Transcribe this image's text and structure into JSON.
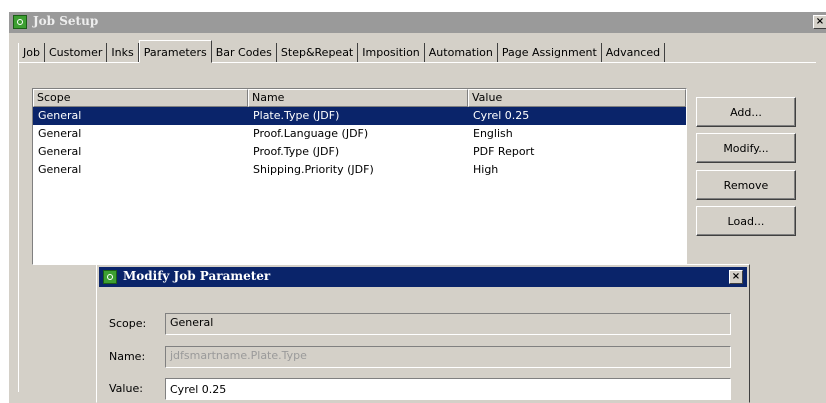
{
  "window": {
    "title": "Job Setup",
    "close_glyph": "×"
  },
  "tabs": [
    {
      "label": "Job"
    },
    {
      "label": "Customer"
    },
    {
      "label": "Inks"
    },
    {
      "label": "Parameters",
      "active": true
    },
    {
      "label": "Bar Codes"
    },
    {
      "label": "Step&Repeat"
    },
    {
      "label": "Imposition"
    },
    {
      "label": "Automation"
    },
    {
      "label": "Page Assignment"
    },
    {
      "label": "Advanced"
    }
  ],
  "table": {
    "columns": [
      "Scope",
      "Name",
      "Value"
    ],
    "rows": [
      {
        "scope": "General",
        "name": "Plate.Type (JDF)",
        "value": "Cyrel 0.25",
        "selected": true
      },
      {
        "scope": "General",
        "name": "Proof.Language (JDF)",
        "value": "English"
      },
      {
        "scope": "General",
        "name": "Proof.Type (JDF)",
        "value": "PDF Report"
      },
      {
        "scope": "General",
        "name": "Shipping.Priority (JDF)",
        "value": "High"
      }
    ]
  },
  "buttons": {
    "add": "Add...",
    "modify": "Modify...",
    "remove": "Remove",
    "load": "Load..."
  },
  "dialog": {
    "title": "Modify Job Parameter",
    "close_glyph": "×",
    "scope_label": "Scope:",
    "scope_value": "General",
    "name_label": "Name:",
    "name_value": "jdfsmartname.Plate.Type",
    "value_label": "Value:",
    "value_value": "Cyrel 0.25"
  },
  "colors": {
    "selection": "#0a246a",
    "window_face": "#d4d0c8",
    "app_icon": "#3d9f32"
  }
}
